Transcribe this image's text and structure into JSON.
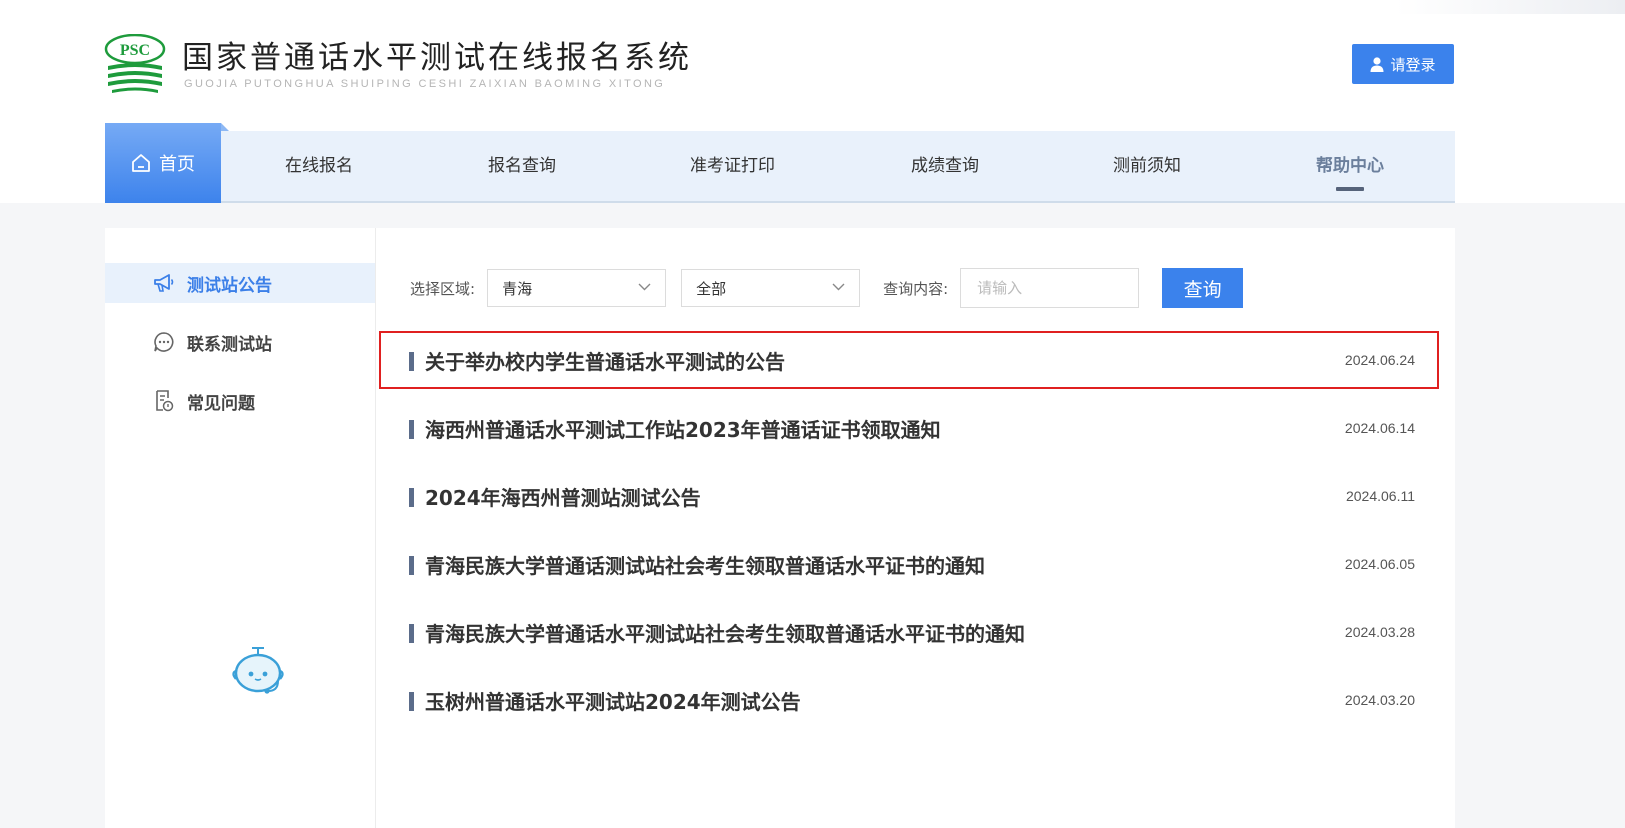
{
  "header": {
    "title": "国家普通话水平测试在线报名系统",
    "subtitle": "GUOJIA PUTONGHUA SHUIPING CESHI ZAIXIAN BAOMING XITONG",
    "logo_text": "PSC",
    "login_label": "请登录"
  },
  "nav": {
    "home": "首页",
    "items": [
      "在线报名",
      "报名查询",
      "准考证打印",
      "成绩查询",
      "测前须知",
      "帮助中心"
    ],
    "active": "帮助中心"
  },
  "sidebar": {
    "items": [
      {
        "label": "测试站公告",
        "icon": "megaphone-icon",
        "active": true
      },
      {
        "label": "联系测试站",
        "icon": "chat-bubble-icon",
        "active": false
      },
      {
        "label": "常见问题",
        "icon": "document-question-icon",
        "active": false
      }
    ]
  },
  "filter": {
    "region_label": "选择区域:",
    "region_value": "青海",
    "scope_value": "全部",
    "query_label": "查询内容:",
    "query_placeholder": "请输入",
    "query_button": "查询"
  },
  "notices": [
    {
      "title": "关于举办校内学生普通话水平测试的公告",
      "date": "2024.06.24",
      "highlighted": true
    },
    {
      "title": "海西州普通话水平测试工作站2023年普通话证书领取通知",
      "date": "2024.06.14"
    },
    {
      "title": "2024年海西州普测站测试公告",
      "date": "2024.06.11"
    },
    {
      "title": "青海民族大学普通话测试站社会考生领取普通话水平证书的通知",
      "date": "2024.06.05"
    },
    {
      "title": "青海民族大学普通话水平测试站社会考生领取普通话水平证书的通知",
      "date": "2024.03.28"
    },
    {
      "title": "玉树州普通话水平测试站2024年测试公告",
      "date": "2024.03.20"
    }
  ],
  "colors": {
    "accent": "#3b82ec",
    "nav_bg": "#e9f1fb",
    "highlight_border": "#e02020",
    "logo_green": "#1e9b3c"
  }
}
